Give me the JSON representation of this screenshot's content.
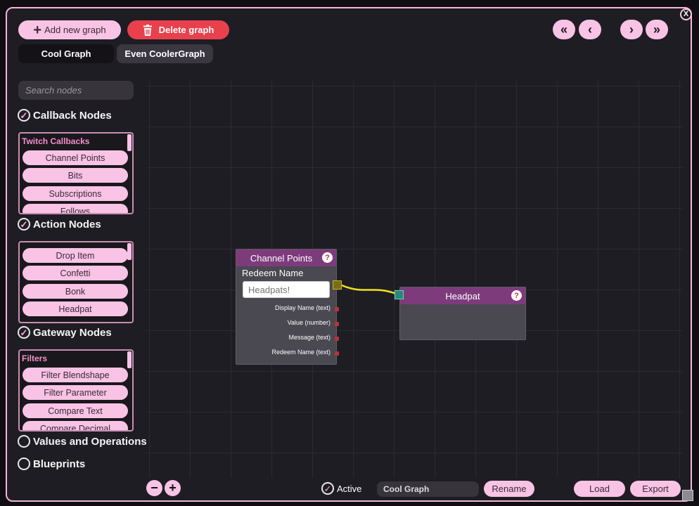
{
  "toolbar": {
    "add_label": "Add new graph",
    "delete_label": "Delete graph"
  },
  "close_label": "X",
  "tabs": [
    {
      "label": "Cool Graph",
      "active": true
    },
    {
      "label": "Even CoolerGraph",
      "active": false
    }
  ],
  "nav": {
    "first": "«",
    "prev": "‹",
    "next": "›",
    "last": "»"
  },
  "search": {
    "placeholder": "Search nodes",
    "value": ""
  },
  "categories": [
    {
      "label": "Callback Nodes",
      "checked": true,
      "list_header": "Twitch Callbacks",
      "items": [
        "Channel Points",
        "Bits",
        "Subscriptions",
        "Follows"
      ]
    },
    {
      "label": "Action Nodes",
      "checked": true,
      "list_header": "",
      "items": [
        "Drop Item",
        "Confetti",
        "Bonk",
        "Headpat"
      ]
    },
    {
      "label": "Gateway Nodes",
      "checked": true,
      "list_header": "Filters",
      "items": [
        "Filter Blendshape",
        "Filter Parameter",
        "Compare Text",
        "Compare Decimal"
      ]
    },
    {
      "label": "Values and Operations",
      "checked": false
    },
    {
      "label": "Blueprints",
      "checked": false
    }
  ],
  "nodes": {
    "channel_points": {
      "title": "Channel Points",
      "field_label": "Redeem Name",
      "field_placeholder": "Headpats!",
      "outputs": [
        "Display Name (text)",
        "Value (number)",
        "Message (text)",
        "Redeem Name (text)"
      ]
    },
    "headpat": {
      "title": "Headpat"
    }
  },
  "colors": {
    "accent_pink": "#f9c3e5",
    "delete_red": "#e8414d",
    "node_header": "#7e3b7c",
    "connection": "#f2e21b"
  },
  "bottom": {
    "zoom_out": "−",
    "zoom_in": "+",
    "active_label": "Active",
    "active_checked": true,
    "graph_name": "Cool Graph",
    "rename_label": "Rename",
    "load_label": "Load",
    "export_label": "Export"
  }
}
